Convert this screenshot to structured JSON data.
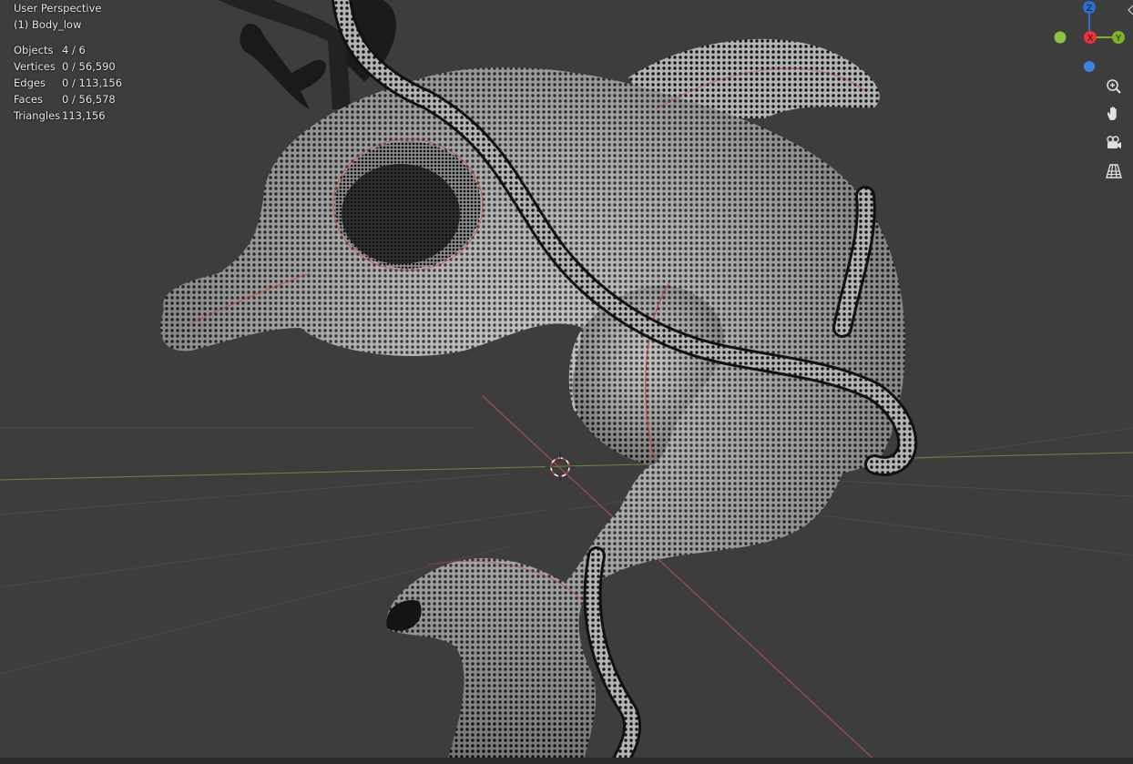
{
  "viewport": {
    "view_name": "User Perspective",
    "active_object": "(1) Body_low",
    "stats": [
      {
        "label": "Objects",
        "value": "4 / 6"
      },
      {
        "label": "Vertices",
        "value": "0 / 56,590"
      },
      {
        "label": "Edges",
        "value": "0 / 113,156"
      },
      {
        "label": "Faces",
        "value": "0 / 56,578"
      },
      {
        "label": "Triangles",
        "value": "113,156"
      }
    ]
  },
  "gizmo": {
    "z_label": "Z",
    "x_label": "X",
    "y_label": "Y",
    "colors": {
      "x": "#e8333d",
      "y": "#7eb228",
      "z": "#2d6fcf",
      "y_neg": "#8bc53f",
      "z_neg": "#3b86e0"
    }
  },
  "nav_buttons": [
    {
      "icon": "zoom-icon"
    },
    {
      "icon": "hand-pan-icon"
    },
    {
      "icon": "camera-icon"
    },
    {
      "icon": "grid-view-icon"
    }
  ],
  "colors": {
    "background": "#3d3d3d",
    "mesh_fill": "#a9a9a9",
    "mesh_dots": "#111111",
    "seam": "#d23a3a",
    "x_axis_line": "#a85050",
    "y_axis_line": "#6d8a3a"
  }
}
